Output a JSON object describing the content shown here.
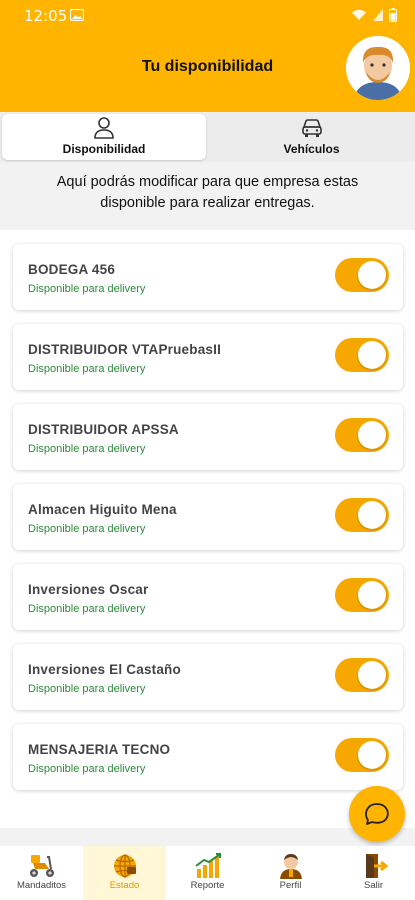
{
  "status_bar": {
    "time": "12:05"
  },
  "header": {
    "title": "Tu disponibilidad"
  },
  "tabs": [
    {
      "label": "Disponibilidad",
      "icon": "person-icon",
      "active": true
    },
    {
      "label": "Vehículos",
      "icon": "car-icon",
      "active": false
    }
  ],
  "intro": {
    "line1": "Aquí podrás modificar para que empresa estas",
    "line2": "disponible para realizar entregas."
  },
  "companies": [
    {
      "name": "BODEGA 456",
      "status": "Disponible para delivery",
      "enabled": true
    },
    {
      "name": "DISTRIBUIDOR VTAPruebasII",
      "status": "Disponible para delivery",
      "enabled": true
    },
    {
      "name": "DISTRIBUIDOR APSSA",
      "status": "Disponible para delivery",
      "enabled": true
    },
    {
      "name": "Almacen Higuito Mena",
      "status": "Disponible para delivery",
      "enabled": true
    },
    {
      "name": "Inversiones Oscar",
      "status": "Disponible para delivery",
      "enabled": true
    },
    {
      "name": "Inversiones El Castaño",
      "status": "Disponible para delivery",
      "enabled": true
    },
    {
      "name": "MENSAJERIA TECNO",
      "status": "Disponible para delivery",
      "enabled": true
    }
  ],
  "bottom_nav": [
    {
      "label": "Mandaditos",
      "icon": "scooter-icon",
      "active": false
    },
    {
      "label": "Estado",
      "icon": "globe-icon",
      "active": true
    },
    {
      "label": "Reporte",
      "icon": "chart-icon",
      "active": false
    },
    {
      "label": "Perfil",
      "icon": "profile-icon",
      "active": false
    },
    {
      "label": "Salir",
      "icon": "exit-icon",
      "active": false
    }
  ],
  "colors": {
    "accent": "#FFB400",
    "toggle_on": "#F6A800",
    "status_text": "#2e8b3a"
  }
}
